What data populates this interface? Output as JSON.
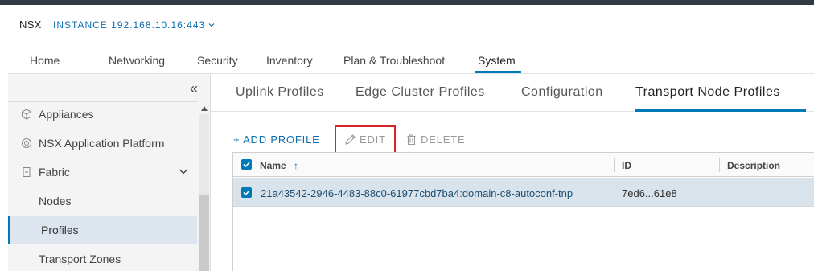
{
  "header": {
    "brand": "NSX",
    "instance": "INSTANCE 192.168.10.16:443"
  },
  "nav": {
    "items": [
      "Home",
      "Networking",
      "Security",
      "Inventory",
      "Plan & Troubleshoot",
      "System"
    ],
    "active": "System"
  },
  "sidebar": {
    "collapse_glyph": "«",
    "items": [
      {
        "label": "Appliances",
        "icon": "cube-icon"
      },
      {
        "label": "NSX Application Platform",
        "icon": "platform-icon"
      },
      {
        "label": "Fabric",
        "icon": "fabric-icon",
        "expanded": true
      },
      {
        "label": "Nodes"
      },
      {
        "label": "Profiles",
        "active": true
      },
      {
        "label": "Transport Zones"
      }
    ]
  },
  "tabs": {
    "items": [
      "Uplink Profiles",
      "Edge Cluster Profiles",
      "Configuration",
      "Transport Node Profiles"
    ],
    "active": "Transport Node Profiles"
  },
  "actions": {
    "add": "+ ADD PROFILE",
    "edit": "EDIT",
    "delete": "DELETE"
  },
  "grid": {
    "columns": [
      "Name",
      "ID",
      "Description"
    ],
    "sort_indicator": "↑",
    "rows": [
      {
        "selected": true,
        "name": "21a43542-2946-4483-88c0-61977cbd7ba4:domain-c8-autoconf-tnp",
        "id": "7ed6...61e8",
        "description": ""
      }
    ]
  },
  "colors": {
    "accent": "#0079b8",
    "link": "#0d6fae",
    "highlight_box": "#d9252a",
    "topbar": "#2f3a44"
  }
}
